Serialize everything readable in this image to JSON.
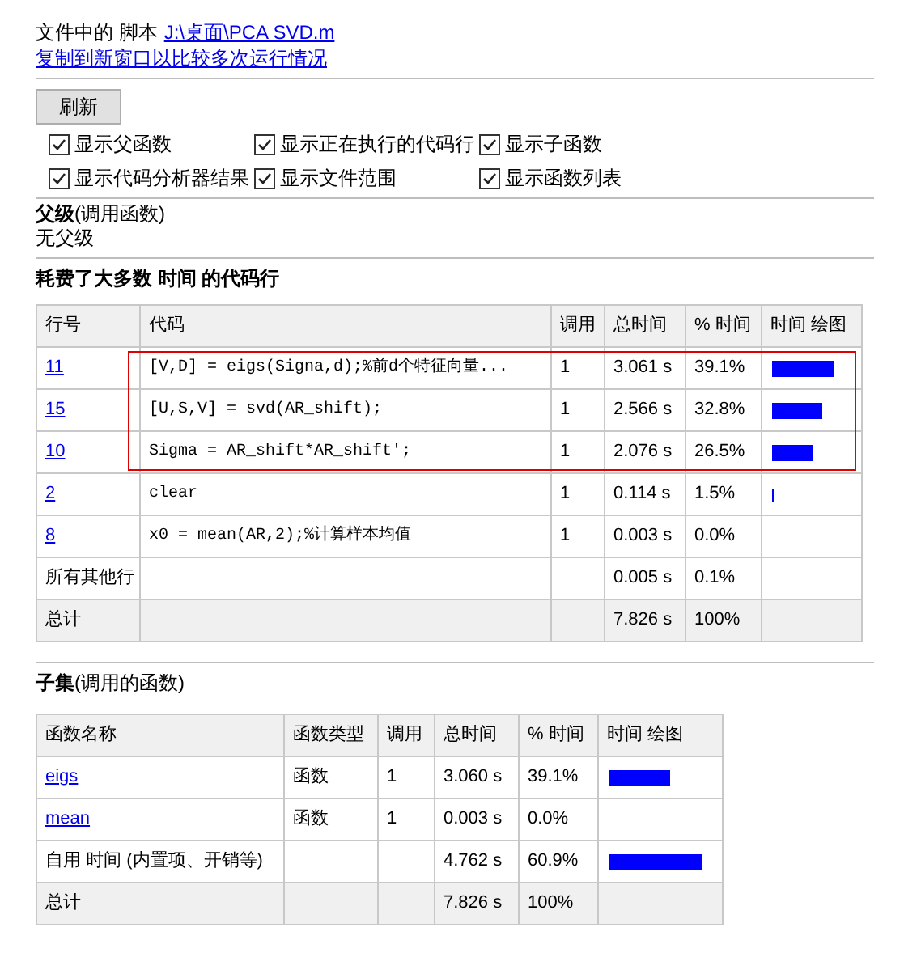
{
  "header": {
    "label": "文件中的 脚本",
    "file_link": "J:\\桌面\\PCA SVD.m",
    "copy_link": "复制到新窗口以比较多次运行情况"
  },
  "refresh_button": "刷新",
  "options": [
    {
      "label": "显示父函数",
      "checked": true
    },
    {
      "label": "显示正在执行的代码行",
      "checked": true
    },
    {
      "label": "显示子函数",
      "checked": true
    },
    {
      "label": "显示代码分析器结果",
      "checked": true
    },
    {
      "label": "显示文件范围",
      "checked": true
    },
    {
      "label": "显示函数列表",
      "checked": true
    }
  ],
  "parents": {
    "title": "父级",
    "subtitle": "(调用函数)",
    "text": "无父级"
  },
  "lines": {
    "title": "耗费了大多数 时间 的代码行",
    "columns": [
      "行号",
      "代码",
      "调用",
      "总时间",
      "% 时间",
      "时间 绘图"
    ],
    "rows": [
      {
        "kind": "link",
        "line": "11",
        "code": "[V,D] = eigs(Signa,d);%前d个特征向量...",
        "calls": "1",
        "total": "3.061 s",
        "pct": "39.1%",
        "highlighted": true
      },
      {
        "kind": "link",
        "line": "15",
        "code": "[U,S,V] = svd(AR_shift);",
        "calls": "1",
        "total": "2.566 s",
        "pct": "32.8%",
        "highlighted": true
      },
      {
        "kind": "link",
        "line": "10",
        "code": "Sigma = AR_shift*AR_shift';",
        "calls": "1",
        "total": "2.076 s",
        "pct": "26.5%",
        "highlighted": true
      },
      {
        "kind": "link",
        "line": "2",
        "code": "clear",
        "calls": "1",
        "total": "0.114 s",
        "pct": "1.5%",
        "highlighted": false
      },
      {
        "kind": "link",
        "line": "8",
        "code": "x0 = mean(AR,2);%计算样本均值",
        "calls": "1",
        "total": "0.003 s",
        "pct": "0.0%",
        "highlighted": false
      },
      {
        "kind": "plain",
        "line": "所有其他行",
        "total": "0.005 s",
        "pct": "0.1%",
        "highlighted": false
      },
      {
        "kind": "total",
        "line": "总计",
        "total": "7.826 s",
        "pct": "100%",
        "highlighted": false
      }
    ]
  },
  "children": {
    "title": "子集",
    "subtitle": "(调用的函数)",
    "columns": [
      "函数名称",
      "函数类型",
      "调用",
      "总时间",
      "% 时间",
      "时间 绘图"
    ],
    "rows": [
      {
        "kind": "link",
        "name": "eigs",
        "type": "函数",
        "calls": "1",
        "total": "3.060 s",
        "pct": "39.1%"
      },
      {
        "kind": "link",
        "name": "mean",
        "type": "函数",
        "calls": "1",
        "total": "0.003 s",
        "pct": "0.0%"
      },
      {
        "kind": "plain",
        "name": "自用 时间 (内置项、开销等)",
        "total": "4.762 s",
        "pct": "60.9%"
      },
      {
        "kind": "total",
        "name": "总计",
        "total": "7.826 s",
        "pct": "100%"
      }
    ]
  }
}
